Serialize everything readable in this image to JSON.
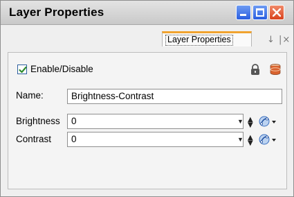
{
  "window": {
    "title": "Layer Properties",
    "controls": [
      "minimize-icon",
      "maximize-icon",
      "close-icon"
    ]
  },
  "tabs": {
    "active_label": "Layer Properties",
    "tools_glyph": "↓ |×"
  },
  "panel": {
    "enable": {
      "label": "Enable/Disable",
      "checked": true
    },
    "icons": [
      "lock-icon",
      "database-icon"
    ],
    "name": {
      "label": "Name:",
      "value": "Brightness-Contrast"
    },
    "params": [
      {
        "label": "Brightness",
        "value": "0"
      },
      {
        "label": "Contrast",
        "value": "0"
      }
    ]
  },
  "colors": {
    "tab_accent": "#f0a32f",
    "close_button": "#d9431d",
    "title_buttons": "#2a5ee0",
    "check_mark": "#2e8b2e"
  }
}
